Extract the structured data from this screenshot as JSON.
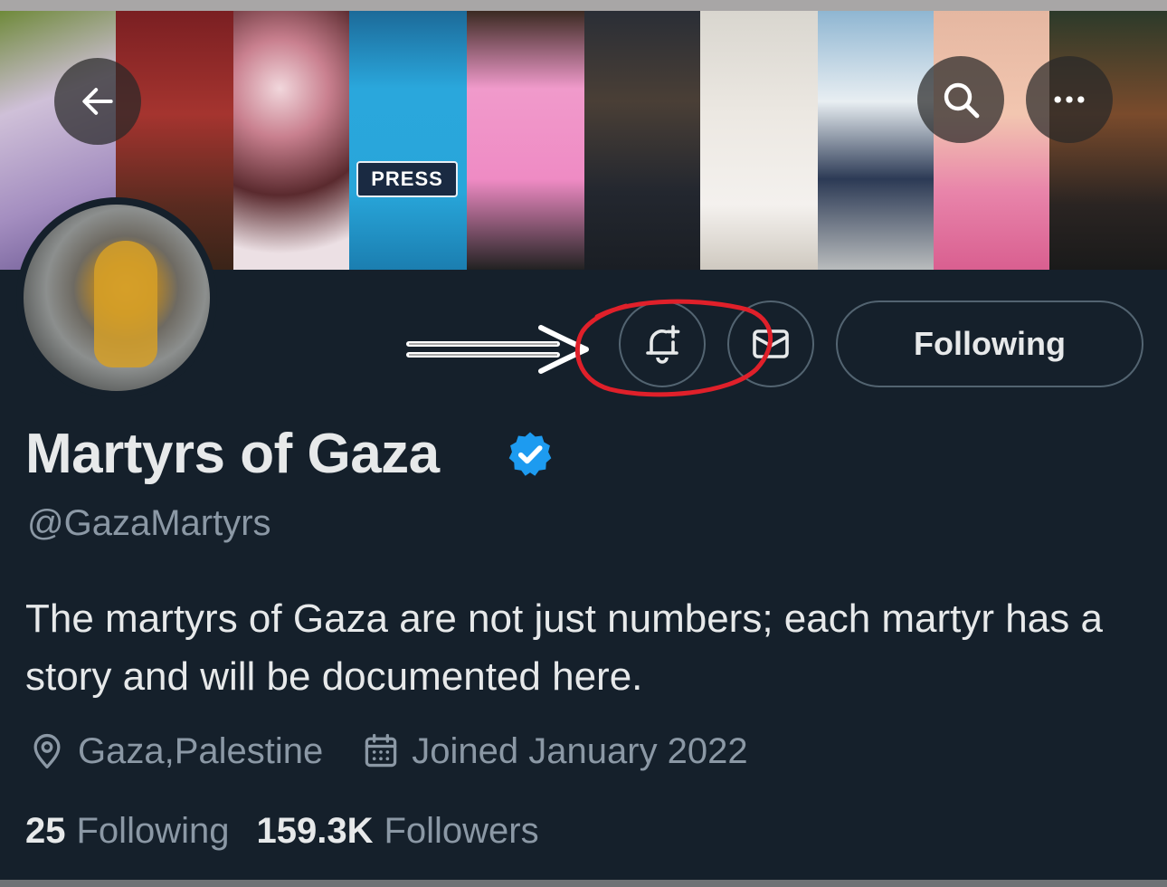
{
  "banner": {
    "press_label": "PRESS"
  },
  "nav": {
    "back_icon": "arrow-left-icon",
    "search_icon": "search-icon",
    "more_icon": "more-horizontal-icon"
  },
  "profile": {
    "display_name": "Martyrs of Gaza",
    "verified": true,
    "handle": "@GazaMartyrs",
    "bio": "The martyrs of Gaza are not just numbers; each martyr has a story and will be documented here.",
    "location": "Gaza,Palestine",
    "joined": "Joined January 2022",
    "following_count": "25",
    "following_label": "Following",
    "followers_count": "159.3K",
    "followers_label": "Followers"
  },
  "actions": {
    "notify_icon": "bell-plus-icon",
    "message_icon": "envelope-icon",
    "follow_state_label": "Following"
  },
  "annotation": {
    "highlight_color": "#e0202a",
    "arrow_color": "#ffffff"
  },
  "colors": {
    "background": "#15202b",
    "text_primary": "#e7e9ea",
    "text_secondary": "#8b98a5",
    "border": "#536471",
    "verified_blue": "#1d9bf0"
  }
}
